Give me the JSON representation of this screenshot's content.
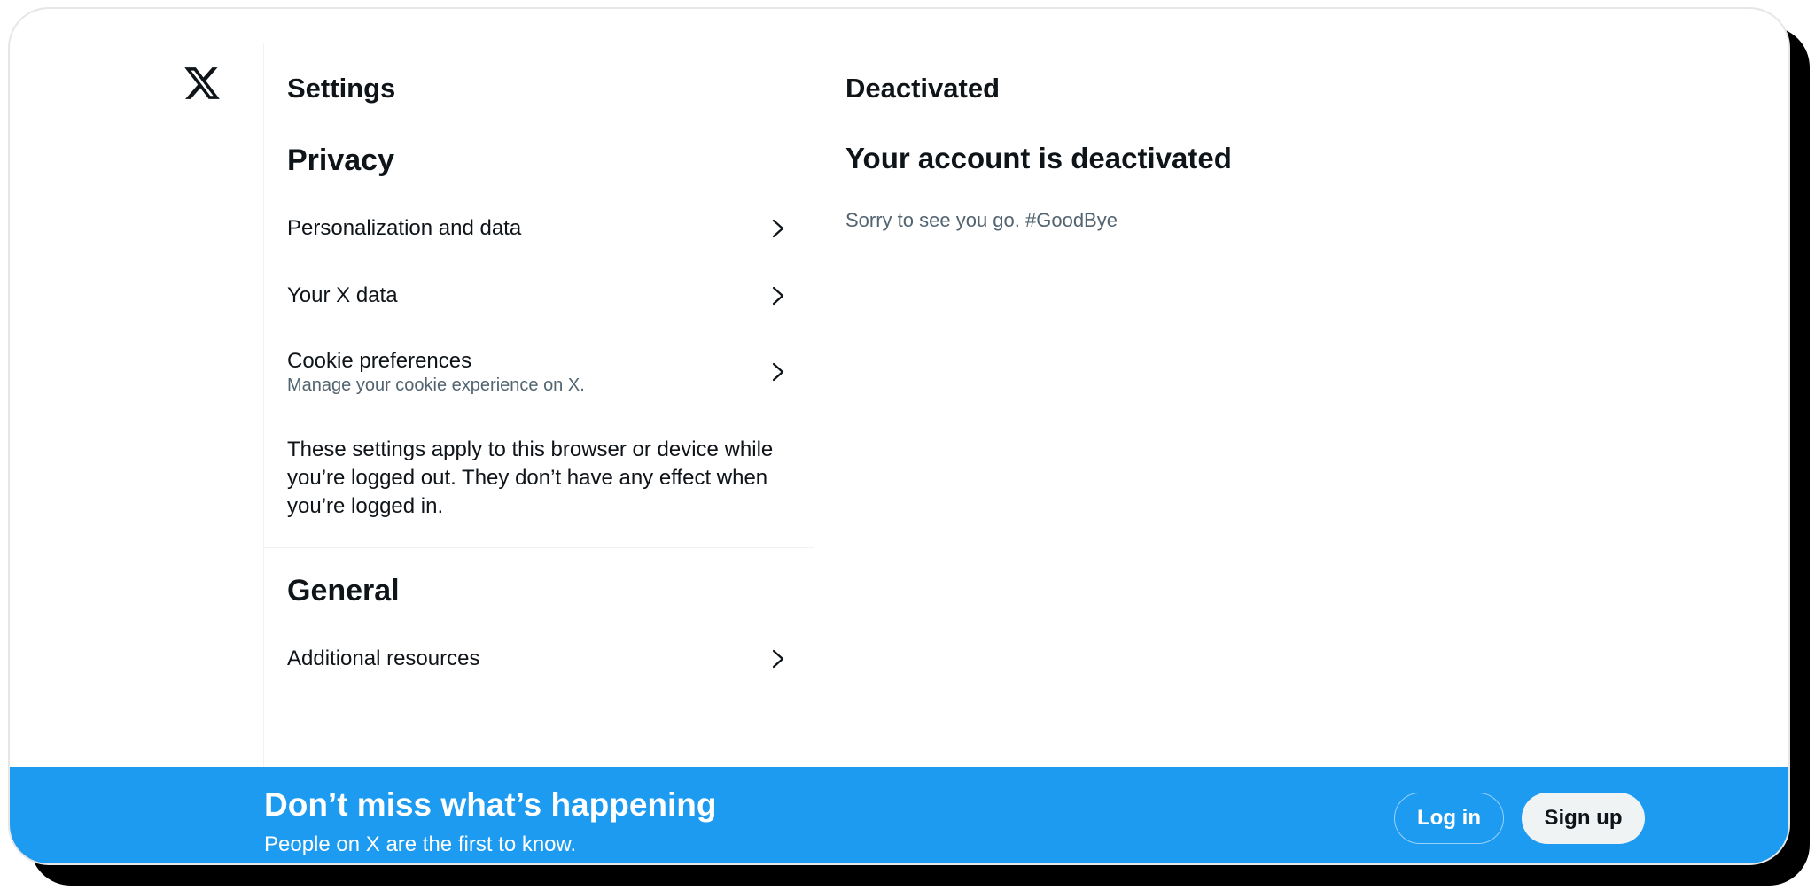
{
  "settings": {
    "title": "Settings",
    "privacy_heading": "Privacy",
    "items": [
      {
        "label": "Personalization and data"
      },
      {
        "label": "Your X data"
      },
      {
        "label": "Cookie preferences",
        "sublabel": "Manage your cookie experience on X."
      }
    ],
    "info_text": "These settings apply to this browser or device while you’re logged out. They don’t have any effect when you’re logged in.",
    "general_heading": "General",
    "general_items": [
      {
        "label": "Additional resources"
      }
    ]
  },
  "detail": {
    "title": "Deactivated",
    "heading": "Your account is deactivated",
    "message": "Sorry to see you go. #GoodBye"
  },
  "banner": {
    "title": "Don’t miss what’s happening",
    "subtitle": "People on X are the first to know.",
    "login_label": "Log in",
    "signup_label": "Sign up"
  },
  "icons": {
    "logo": "x-logo-icon",
    "chevron": "chevron-right-icon"
  },
  "colors": {
    "brand_blue": "#1d9bf0",
    "text_primary": "#0f1419",
    "text_secondary": "#536471"
  }
}
